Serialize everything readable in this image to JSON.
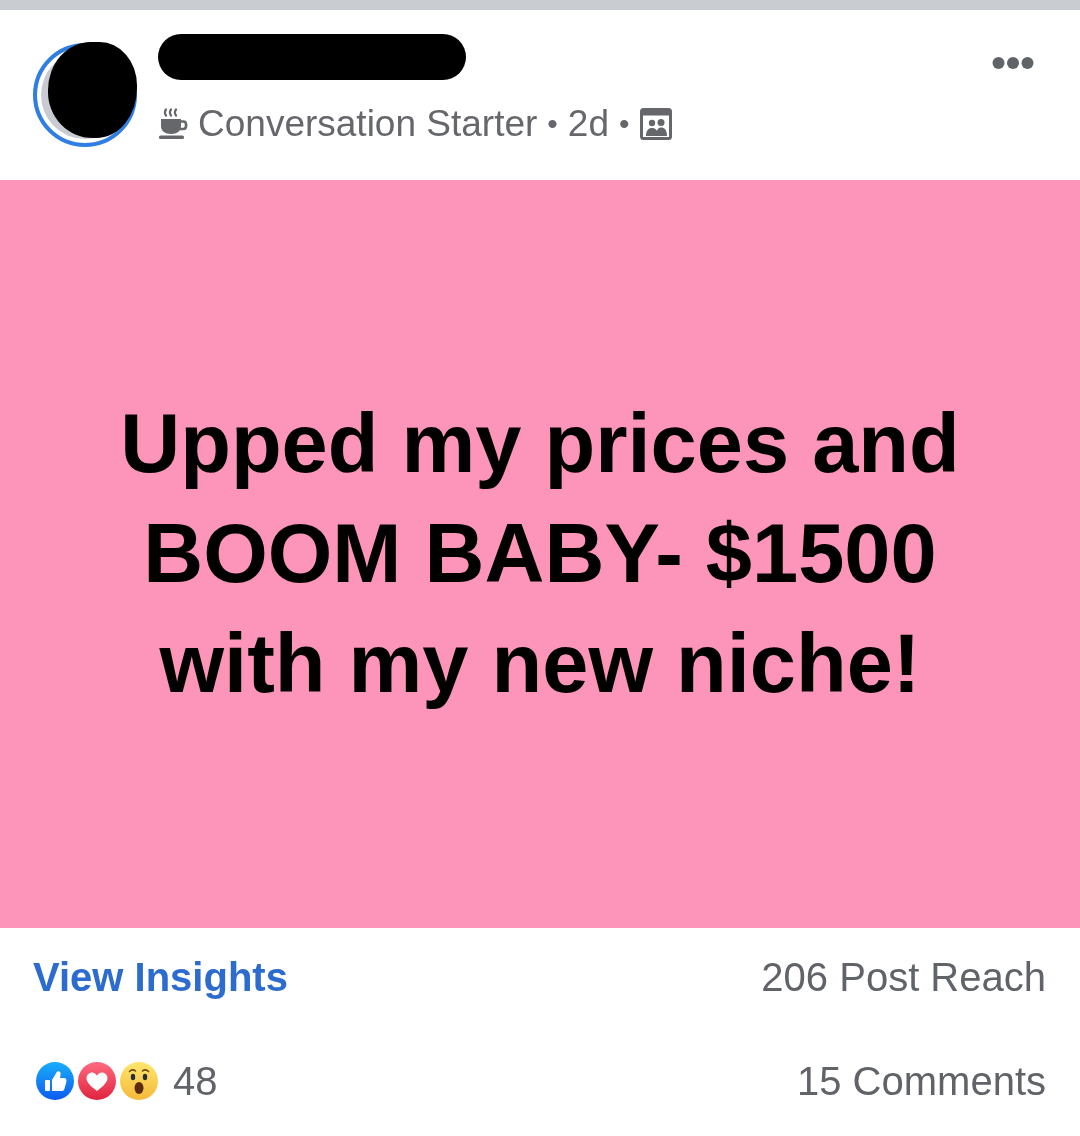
{
  "post": {
    "author": {
      "avatar_story_ring": true,
      "avatar_redacted": true,
      "name_redacted": true
    },
    "meta": [
      {
        "kind": "badge",
        "text": "Conversation Starter"
      },
      {
        "kind": "separator",
        "text": "•"
      },
      {
        "kind": "time",
        "text": "2d"
      },
      {
        "kind": "separator",
        "text": "•"
      },
      {
        "kind": "audience"
      }
    ],
    "text": "Upped my prices and\nBOOM BABY- $1500\nwith my new niche!"
  },
  "insights": {
    "link": "View Insights",
    "reach": "206 Post Reach"
  },
  "engagement": {
    "reactions": [
      {
        "kind": "like"
      },
      {
        "kind": "love"
      },
      {
        "kind": "wow"
      }
    ],
    "reaction_count": "48",
    "comments": "15 Comments"
  }
}
